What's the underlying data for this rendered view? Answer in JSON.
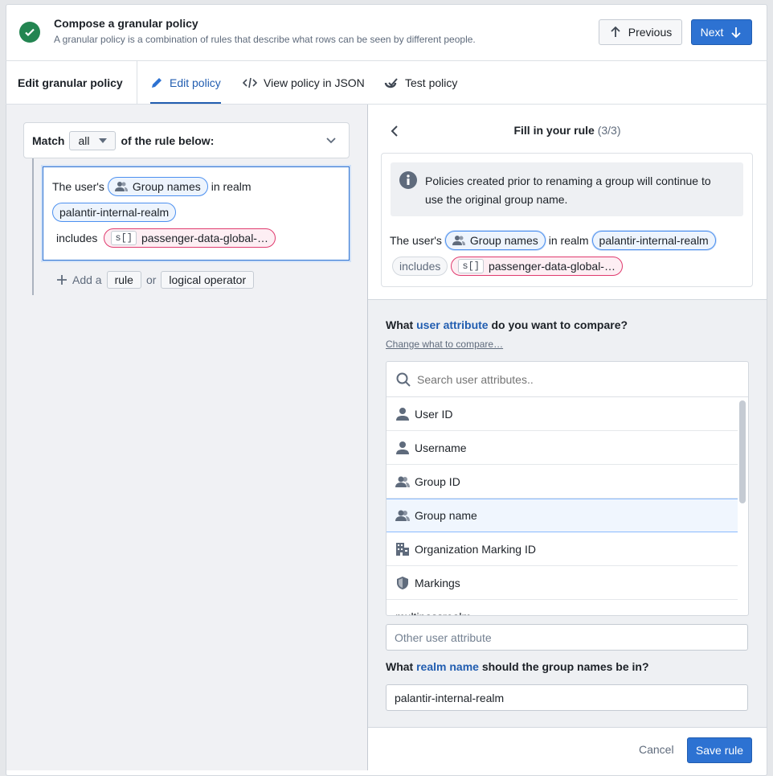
{
  "header": {
    "title": "Compose a granular policy",
    "subtitle": "A granular policy is a combination of rules that describe what rows can be seen by different people.",
    "previous_label": "Previous",
    "next_label": "Next",
    "status_color": "#238551",
    "accent": "#2d72d2"
  },
  "tabs": {
    "section_label": "Edit granular policy",
    "items": [
      {
        "label": "Edit policy",
        "icon": "pencil-icon",
        "active": true
      },
      {
        "label": "View policy in JSON",
        "icon": "code-icon"
      },
      {
        "label": "Test policy",
        "icon": "test-icon"
      }
    ]
  },
  "left": {
    "match_label": "Match",
    "match_value": "all",
    "match_suffix": "of the rule below:",
    "rule": {
      "prefix": "The user's",
      "attribute": "Group names",
      "in_realm": "in realm",
      "realm": "palantir-internal-realm",
      "operator": "includes",
      "value_type": "s[]",
      "value": "passenger-data-global-…"
    },
    "add_a": "Add a",
    "rule_button": "rule",
    "or": "or",
    "logical_button": "logical operator"
  },
  "right": {
    "title": "Fill in your rule",
    "step": "(3/3)",
    "info": "Policies created prior to renaming a group will continue to use the original group name.",
    "rule": {
      "prefix": "The user's",
      "attribute": "Group names",
      "in_realm": "in realm",
      "realm": "palantir-internal-realm",
      "operator": "includes",
      "value_type": "s[]",
      "value": "passenger-data-global-…"
    },
    "q1_pre": "What",
    "q1_hl": "user attribute",
    "q1_post": "do you want to compare?",
    "change_link": "Change what to compare…",
    "search_placeholder": "Search user attributes..",
    "attributes": [
      {
        "label": "User ID",
        "icon": "person-icon"
      },
      {
        "label": "Username",
        "icon": "person-icon"
      },
      {
        "label": "Group ID",
        "icon": "people-icon"
      },
      {
        "label": "Group name",
        "icon": "people-icon",
        "selected": true
      },
      {
        "label": "Organization Marking ID",
        "icon": "office-icon"
      },
      {
        "label": "Markings",
        "icon": "shield-icon"
      },
      {
        "label": "multipassrealm",
        "icon": ""
      }
    ],
    "other_placeholder": "Other user attribute",
    "q2_pre": "What",
    "q2_hl": "realm name",
    "q2_post": "should the group names be in?",
    "realm_value": "palantir-internal-realm",
    "cancel_label": "Cancel",
    "save_label": "Save rule"
  }
}
